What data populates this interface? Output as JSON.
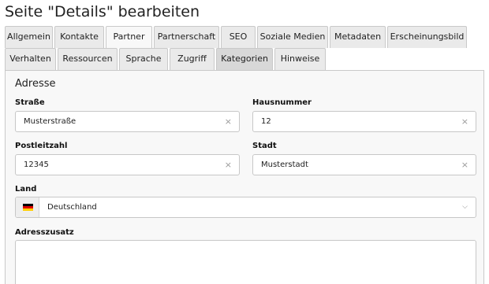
{
  "page_title": "Seite \"Details\" bearbeiten",
  "tabs_row1": [
    {
      "label": "Allgemein",
      "name": "tab-allgemein"
    },
    {
      "label": "Kontakte",
      "name": "tab-kontakte"
    },
    {
      "label": "Partner",
      "name": "tab-partner"
    },
    {
      "label": "Partnerschaft",
      "name": "tab-partnerschaft"
    },
    {
      "label": "SEO",
      "name": "tab-seo"
    },
    {
      "label": "Soziale Medien",
      "name": "tab-soziale-medien"
    },
    {
      "label": "Metadaten",
      "name": "tab-metadaten"
    },
    {
      "label": "Erscheinungsbild",
      "name": "tab-erscheinungsbild"
    }
  ],
  "tabs_row2": [
    {
      "label": "Verhalten",
      "name": "tab-verhalten"
    },
    {
      "label": "Ressourcen",
      "name": "tab-ressourcen"
    },
    {
      "label": "Sprache",
      "name": "tab-sprache"
    },
    {
      "label": "Zugriff",
      "name": "tab-zugriff"
    },
    {
      "label": "Kategorien",
      "name": "tab-kategorien"
    },
    {
      "label": "Hinweise",
      "name": "tab-hinweise"
    }
  ],
  "active_tab": "Partner",
  "section": {
    "title": "Adresse"
  },
  "fields": {
    "strasse": {
      "label": "Straße",
      "value": "Musterstraße"
    },
    "hausnummer": {
      "label": "Hausnummer",
      "value": "12"
    },
    "postleitzahl": {
      "label": "Postleitzahl",
      "value": "12345"
    },
    "stadt": {
      "label": "Stadt",
      "value": "Musterstadt"
    },
    "land": {
      "label": "Land",
      "value": "Deutschland",
      "flag_icon": "germany-flag-icon"
    },
    "adresszusatz": {
      "label": "Adresszusatz",
      "value": ""
    }
  },
  "icons": {
    "clear": "×",
    "dropdown": "⌵"
  },
  "colors": {
    "tab_bg": "#eaeaea",
    "tab_active_bg": "#f8f8f8",
    "panel_bg": "#f8f8f8",
    "border": "#c9c9c9"
  }
}
